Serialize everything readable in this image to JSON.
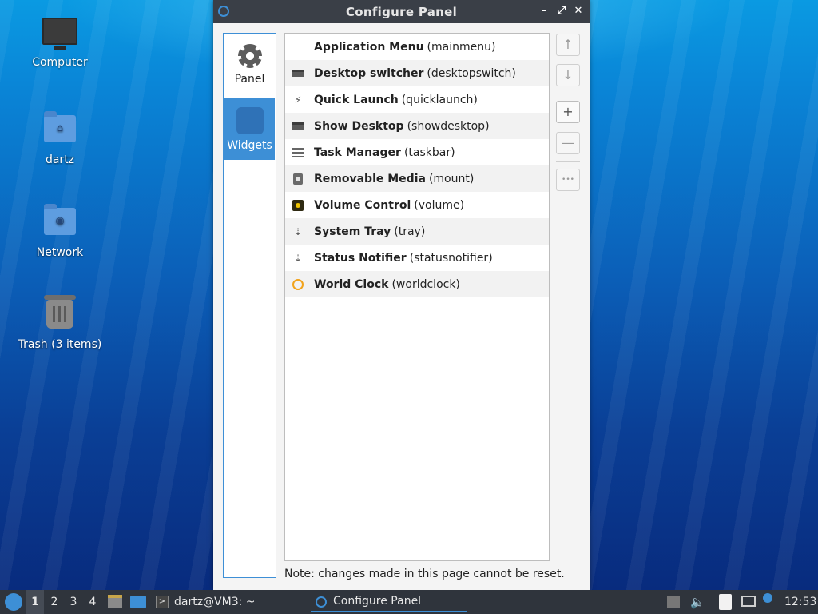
{
  "desktop": {
    "icons": [
      {
        "label": "Computer"
      },
      {
        "label": "dartz"
      },
      {
        "label": "Network"
      },
      {
        "label": "Trash (3 items)"
      }
    ]
  },
  "window": {
    "title": "Configure Panel",
    "controls": {
      "minimize": "–",
      "maximize": "⤢",
      "close": "✕"
    },
    "sidebar": [
      {
        "label": "Panel",
        "icon": "gear-icon",
        "active": false
      },
      {
        "label": "Widgets",
        "icon": "puzzle-icon",
        "active": true
      }
    ],
    "widgets": [
      {
        "name": "Application Menu",
        "id": "(mainmenu)",
        "icon": "menu-icon"
      },
      {
        "name": "Desktop switcher",
        "id": "(desktopswitch)",
        "icon": "desktop-switcher-icon"
      },
      {
        "name": "Quick Launch",
        "id": "(quicklaunch)",
        "icon": "lightning-icon"
      },
      {
        "name": "Show Desktop",
        "id": "(showdesktop)",
        "icon": "show-desktop-icon"
      },
      {
        "name": "Task Manager",
        "id": "(taskbar)",
        "icon": "task-manager-icon"
      },
      {
        "name": "Removable Media",
        "id": "(mount)",
        "icon": "removable-media-icon"
      },
      {
        "name": "Volume Control",
        "id": "(volume)",
        "icon": "volume-icon"
      },
      {
        "name": "System Tray",
        "id": "(tray)",
        "icon": "tray-icon"
      },
      {
        "name": "Status Notifier",
        "id": "(statusnotifier)",
        "icon": "status-notifier-icon"
      },
      {
        "name": "World Clock",
        "id": "(worldclock)",
        "icon": "clock-icon"
      }
    ],
    "toolbar": {
      "up": "↑",
      "down": "↓",
      "add": "+",
      "remove": "—",
      "settings": "•••"
    },
    "note": "Note: changes made in this page cannot be reset."
  },
  "taskbar": {
    "desktops": [
      "1",
      "2",
      "3",
      "4"
    ],
    "active_desktop": "1",
    "tasks": [
      {
        "label": "dartz@VM3: ~",
        "icon": "terminal-icon"
      },
      {
        "label": "Configure Panel",
        "icon": "configure-icon",
        "active": true
      }
    ],
    "clock": "12:53"
  },
  "colors": {
    "accent": "#3d8fd6",
    "titlebar": "#3a3f47",
    "taskbar": "#2f343c"
  }
}
